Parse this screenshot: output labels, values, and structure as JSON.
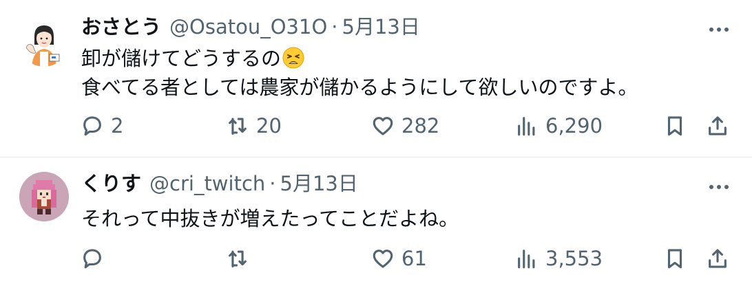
{
  "tweets": [
    {
      "name": "おさとう",
      "handle": "@Osatou_O31O",
      "separator": "·",
      "date": "5月13日",
      "lines": [
        "卸が儲けてどうするの",
        "食べてる者としては農家が儲かるようにして欲しいのですよ。"
      ],
      "emoji": "weary-face",
      "replies": "2",
      "retweets": "20",
      "likes": "282",
      "views": "6,290"
    },
    {
      "name": "くりす",
      "handle": "@cri_twitch",
      "separator": "·",
      "date": "5月13日",
      "lines": [
        "それって中抜きが増えたってことだよね。"
      ],
      "replies": "",
      "retweets": "",
      "likes": "61",
      "views": "3,553"
    }
  ],
  "colors": {
    "text": "#0f1419",
    "secondary": "#536471",
    "divider": "#e6e9ec"
  },
  "icons": [
    "reply-icon",
    "retweet-icon",
    "like-icon",
    "views-icon",
    "bookmark-icon",
    "share-icon",
    "more-icon"
  ]
}
